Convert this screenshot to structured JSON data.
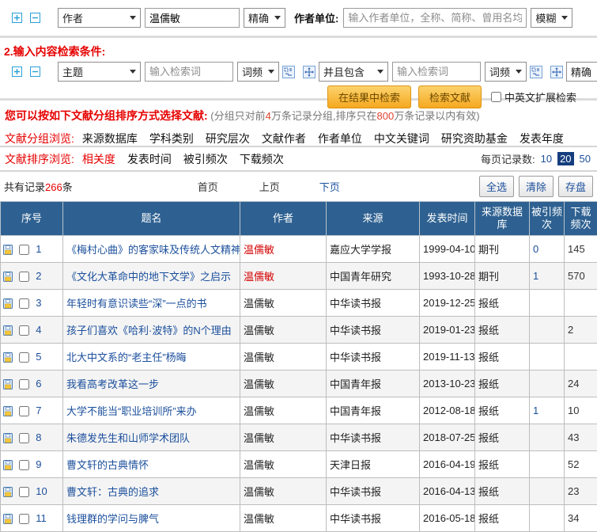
{
  "icons_note": "all icons are drawn as inline svg/css shapes; semantic names on data-name",
  "search_bar": {
    "field_select": "作者",
    "field_value": "温儒敏",
    "match_select": "精确",
    "unit_label": "作者单位:",
    "unit_placeholder": "输入作者单位，全称、简称、曾用名均可",
    "unit_match_select": "模糊"
  },
  "content_search": {
    "section_title": "2.输入内容检索条件:",
    "field_select": "主题",
    "term1_placeholder": "输入检索词",
    "freq1_select": "词频",
    "operator_select": "并且包含",
    "term2_placeholder": "输入检索词",
    "freq2_select": "词频",
    "match_select": "精确",
    "search_in_results_button": "在结果中检索",
    "search_button": "检索文献",
    "extend_checkbox_label": "中英文扩展检索"
  },
  "group_section": {
    "title": "您可以按如下文献分组排序方式选择文献:",
    "note_parts": [
      "(分组只对前",
      "4",
      "万条记录分组,排序只在",
      "800",
      "万条记录以内有效)"
    ],
    "browse_label": "文献分组浏览:",
    "links": [
      "来源数据库",
      "学科类别",
      "研究层次",
      "文献作者",
      "作者单位",
      "中文关键词",
      "研究资助基金",
      "发表年度"
    ]
  },
  "sort_section": {
    "label": "文献排序浏览:",
    "active": "相关度",
    "links": [
      "发表时间",
      "被引频次",
      "下载频次"
    ],
    "page_size_label": "每页记录数:",
    "page_sizes": [
      "10",
      "20",
      "50"
    ],
    "page_size_selected": "20"
  },
  "pagination": {
    "total_prefix": "共有记录",
    "total_count": "266",
    "total_suffix": "条",
    "first": "首页",
    "prev": "上页",
    "next": "下页",
    "select_all": "全选",
    "clear": "清除",
    "save": "存盘"
  },
  "table": {
    "headers": [
      "序号",
      "题名",
      "作者",
      "来源",
      "发表时间",
      "来源数据库",
      "被引频次",
      "下载频次"
    ],
    "rows": [
      {
        "idx": "1",
        "title": "《梅村心曲》的客家味及传统人文精神",
        "author": "温儒敏",
        "author_hl": true,
        "source": "嘉应大学学报",
        "date": "1999-04-10",
        "db": "期刊",
        "cited": "0",
        "dl": "145"
      },
      {
        "idx": "2",
        "title": "《文化大革命中的地下文学》之启示",
        "author": "温儒敏",
        "author_hl": true,
        "source": "中国青年研究",
        "date": "1993-10-28",
        "db": "期刊",
        "cited": "1",
        "dl": "570"
      },
      {
        "idx": "3",
        "title": "年轻时有意识读些“深”一点的书",
        "author": "温儒敏",
        "author_hl": false,
        "source": "中华读书报",
        "date": "2019-12-25",
        "db": "报纸",
        "cited": "",
        "dl": ""
      },
      {
        "idx": "4",
        "title": "孩子们喜欢《哈利·波特》的N个理由",
        "author": "温儒敏",
        "author_hl": false,
        "source": "中华读书报",
        "date": "2019-01-23",
        "db": "报纸",
        "cited": "",
        "dl": "2"
      },
      {
        "idx": "5",
        "title": "北大中文系的“老主任”杨晦",
        "author": "温儒敏",
        "author_hl": false,
        "source": "中华读书报",
        "date": "2019-11-13",
        "db": "报纸",
        "cited": "",
        "dl": ""
      },
      {
        "idx": "6",
        "title": "我看高考改革这一步",
        "author": "温儒敏",
        "author_hl": false,
        "source": "中国青年报",
        "date": "2013-10-23",
        "db": "报纸",
        "cited": "",
        "dl": "24"
      },
      {
        "idx": "7",
        "title": "大学不能当“职业培训所”来办",
        "author": "温儒敏",
        "author_hl": false,
        "source": "中国青年报",
        "date": "2012-08-18",
        "db": "报纸",
        "cited": "1",
        "dl": "10"
      },
      {
        "idx": "8",
        "title": "朱德发先生和山师学术团队",
        "author": "温儒敏",
        "author_hl": false,
        "source": "中华读书报",
        "date": "2018-07-25",
        "db": "报纸",
        "cited": "",
        "dl": "43"
      },
      {
        "idx": "9",
        "title": "曹文轩的古典情怀",
        "author": "温儒敏",
        "author_hl": false,
        "source": "天津日报",
        "date": "2016-04-19",
        "db": "报纸",
        "cited": "",
        "dl": "52"
      },
      {
        "idx": "10",
        "title": "曹文轩：古典的追求",
        "author": "温儒敏",
        "author_hl": false,
        "source": "中华读书报",
        "date": "2016-04-13",
        "db": "报纸",
        "cited": "",
        "dl": "23"
      },
      {
        "idx": "11",
        "title": "钱理群的学问与脾气",
        "author": "温儒敏",
        "author_hl": false,
        "source": "中华读书报",
        "date": "2016-05-18",
        "db": "报纸",
        "cited": "",
        "dl": "34"
      }
    ]
  }
}
